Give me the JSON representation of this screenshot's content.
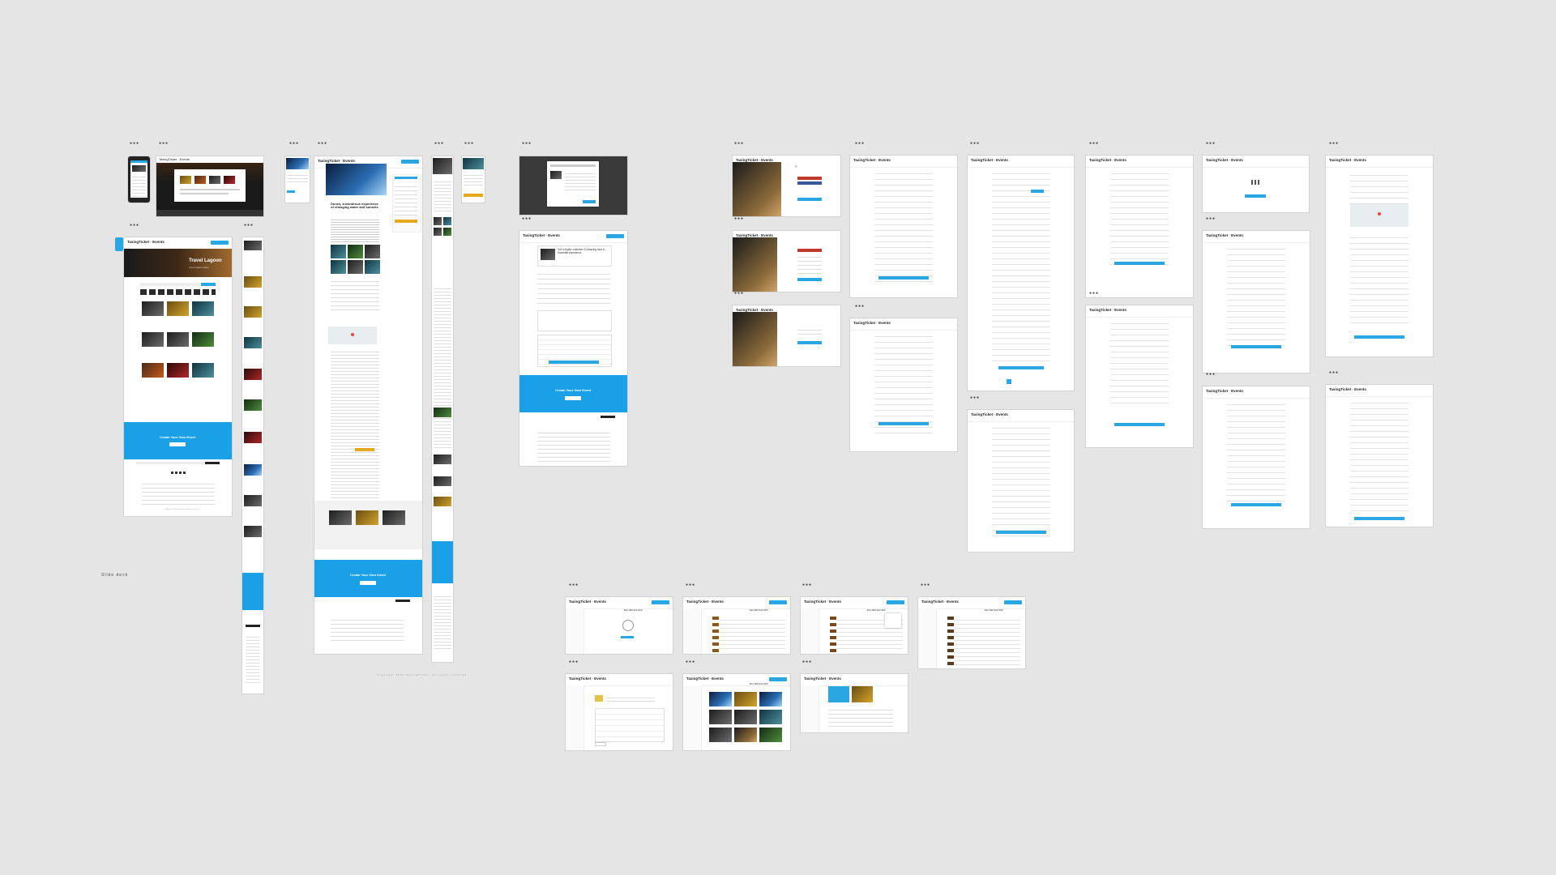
{
  "brand": "TaxingTicket · Events",
  "brand_short": "TaxingTicket · Events",
  "hero_title": "Travel Lagoon",
  "hero_sub": "Lorem ipsum dolor",
  "cta_title": "Create Your Own Event",
  "cta_button": "Get started",
  "side_note": "Slide deck",
  "detail_title": "Dunes, a wondrous experience of changing water and sunsets",
  "order_title": "Get a mystic collection & Amazing food & Essential experience",
  "dashboard_amount": "$12,999   $12,999",
  "footer_note": "Copyright 2024 TaxingTicket. All rights reserved.",
  "colors": {
    "background": "#e5e5e5",
    "accent": "#2aa6e2",
    "hero_dark": "#1a1a1a",
    "cta": "#1aa0e6",
    "yellow": "#e4a91c"
  },
  "icons": [
    "ellipsis-icon",
    "play-icon",
    "spiral-icon",
    "calendar-icon",
    "avatar-icon"
  ]
}
